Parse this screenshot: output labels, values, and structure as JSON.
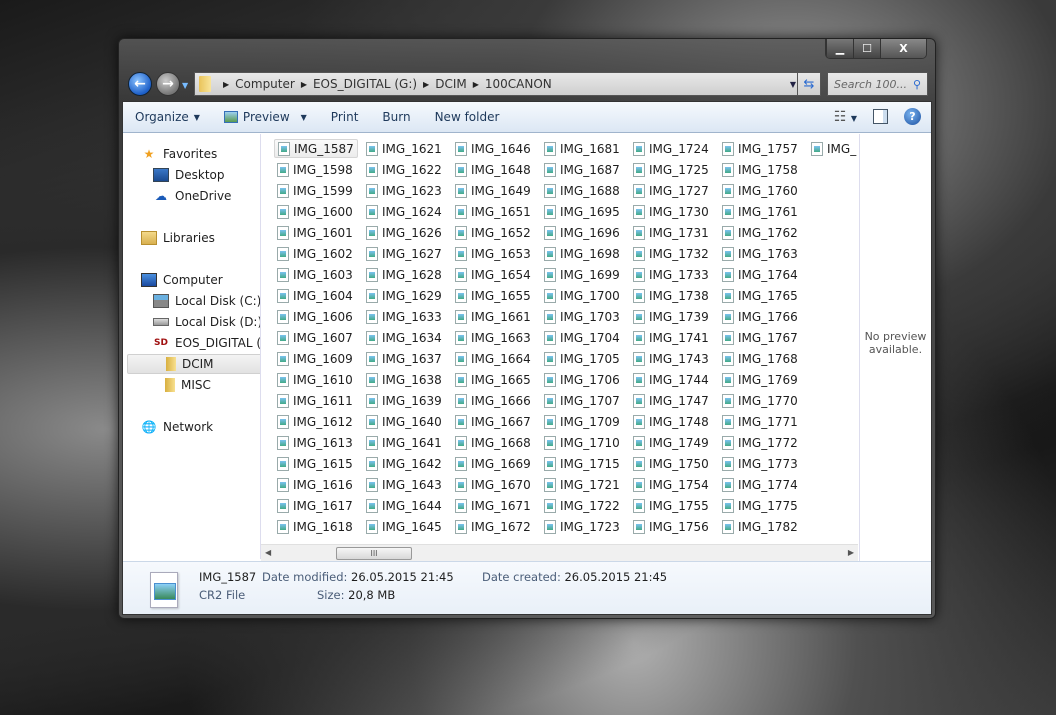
{
  "window": {
    "minimize": "▁",
    "maximize": "☐",
    "close": "X"
  },
  "address": {
    "crumbs": [
      "Computer",
      "EOS_DIGITAL (G:)",
      "DCIM",
      "100CANON"
    ],
    "search_placeholder": "Search 100..."
  },
  "toolbar": {
    "organize": "Organize",
    "preview": "Preview",
    "print": "Print",
    "burn": "Burn",
    "new_folder": "New folder",
    "help": "?"
  },
  "nav": {
    "favorites": "Favorites",
    "desktop": "Desktop",
    "onedrive": "OneDrive",
    "libraries": "Libraries",
    "computer": "Computer",
    "local_c": "Local Disk (C:)",
    "local_d": "Local Disk (D:)",
    "eos": "EOS_DIGITAL (G:)",
    "dcim": "DCIM",
    "misc": "MISC",
    "network": "Network"
  },
  "files": [
    [
      "IMG_1587",
      "IMG_1598",
      "IMG_1599",
      "IMG_1600",
      "IMG_1601",
      "IMG_1602",
      "IMG_1603",
      "IMG_1604",
      "IMG_1606",
      "IMG_1607",
      "IMG_1609",
      "IMG_1610",
      "IMG_1611",
      "IMG_1612",
      "IMG_1613",
      "IMG_1615",
      "IMG_1616",
      "IMG_1617",
      "IMG_1618"
    ],
    [
      "IMG_1621",
      "IMG_1622",
      "IMG_1623",
      "IMG_1624",
      "IMG_1626",
      "IMG_1627",
      "IMG_1628",
      "IMG_1629",
      "IMG_1633",
      "IMG_1634",
      "IMG_1637",
      "IMG_1638",
      "IMG_1639",
      "IMG_1640",
      "IMG_1641",
      "IMG_1642",
      "IMG_1643",
      "IMG_1644",
      "IMG_1645"
    ],
    [
      "IMG_1646",
      "IMG_1648",
      "IMG_1649",
      "IMG_1651",
      "IMG_1652",
      "IMG_1653",
      "IMG_1654",
      "IMG_1655",
      "IMG_1661",
      "IMG_1663",
      "IMG_1664",
      "IMG_1665",
      "IMG_1666",
      "IMG_1667",
      "IMG_1668",
      "IMG_1669",
      "IMG_1670",
      "IMG_1671",
      "IMG_1672"
    ],
    [
      "IMG_1681",
      "IMG_1687",
      "IMG_1688",
      "IMG_1695",
      "IMG_1696",
      "IMG_1698",
      "IMG_1699",
      "IMG_1700",
      "IMG_1703",
      "IMG_1704",
      "IMG_1705",
      "IMG_1706",
      "IMG_1707",
      "IMG_1709",
      "IMG_1710",
      "IMG_1715",
      "IMG_1721",
      "IMG_1722",
      "IMG_1723"
    ],
    [
      "IMG_1724",
      "IMG_1725",
      "IMG_1727",
      "IMG_1730",
      "IMG_1731",
      "IMG_1732",
      "IMG_1733",
      "IMG_1738",
      "IMG_1739",
      "IMG_1741",
      "IMG_1743",
      "IMG_1744",
      "IMG_1747",
      "IMG_1748",
      "IMG_1749",
      "IMG_1750",
      "IMG_1754",
      "IMG_1755",
      "IMG_1756"
    ],
    [
      "IMG_1757",
      "IMG_1758",
      "IMG_1760",
      "IMG_1761",
      "IMG_1762",
      "IMG_1763",
      "IMG_1764",
      "IMG_1765",
      "IMG_1766",
      "IMG_1767",
      "IMG_1768",
      "IMG_1769",
      "IMG_1770",
      "IMG_1771",
      "IMG_1772",
      "IMG_1773",
      "IMG_1774",
      "IMG_1775",
      "IMG_1782"
    ],
    [
      "IMG_"
    ]
  ],
  "preview_pane": {
    "text": "No preview available."
  },
  "details": {
    "name": "IMG_1587",
    "type": "CR2 File",
    "modified_label": "Date modified:",
    "modified": "26.05.2015 21:45",
    "created_label": "Date created:",
    "created": "26.05.2015 21:45",
    "size_label": "Size:",
    "size": "20,8 MB"
  }
}
